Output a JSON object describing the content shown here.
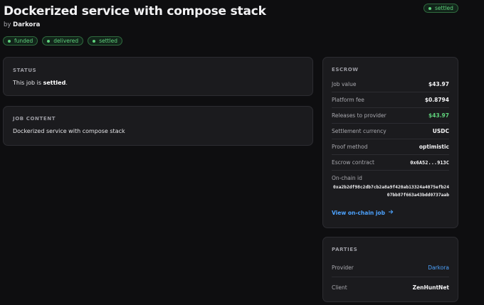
{
  "job": {
    "title": "Dockerized service with compose stack",
    "by_prefix": "by",
    "author": "Darkora",
    "top_status": "settled",
    "badges": [
      "funded",
      "delivered",
      "settled"
    ]
  },
  "status_card": {
    "label": "STATUS",
    "text_prefix": "This job is",
    "status": "settled",
    "text_suffix": "."
  },
  "content_card": {
    "label": "JOB CONTENT",
    "text": "Dockerized service with compose stack"
  },
  "escrow": {
    "label": "ESCROW",
    "rows": [
      {
        "key": "Job value",
        "value": "$43.97"
      },
      {
        "key": "Platform fee",
        "value": "$0.8794"
      },
      {
        "key": "Releases to provider",
        "value": "$43.97"
      },
      {
        "key": "Settlement currency",
        "value": "USDC"
      },
      {
        "key": "Proof method",
        "value": "optimistic"
      },
      {
        "key": "Escrow contract",
        "value": "0x6A52...913C"
      }
    ],
    "onchain_label": "On-chain id",
    "onchain_id": "0xa2b2df98c2db7cb2a8a9f420ab13324a4075efb2407bb87f663a43bdd0737aab",
    "link_label": "View on-chain job"
  },
  "parties": {
    "label": "PARTIES",
    "provider_label": "Provider",
    "provider": "Darkora",
    "client_label": "Client",
    "client": "ZenHuntNet"
  },
  "colors": {
    "accent_green": "#5fd27c",
    "link_blue": "#4da3ff",
    "card_bg": "#1b1b1e",
    "page_bg": "#0e0e10"
  }
}
